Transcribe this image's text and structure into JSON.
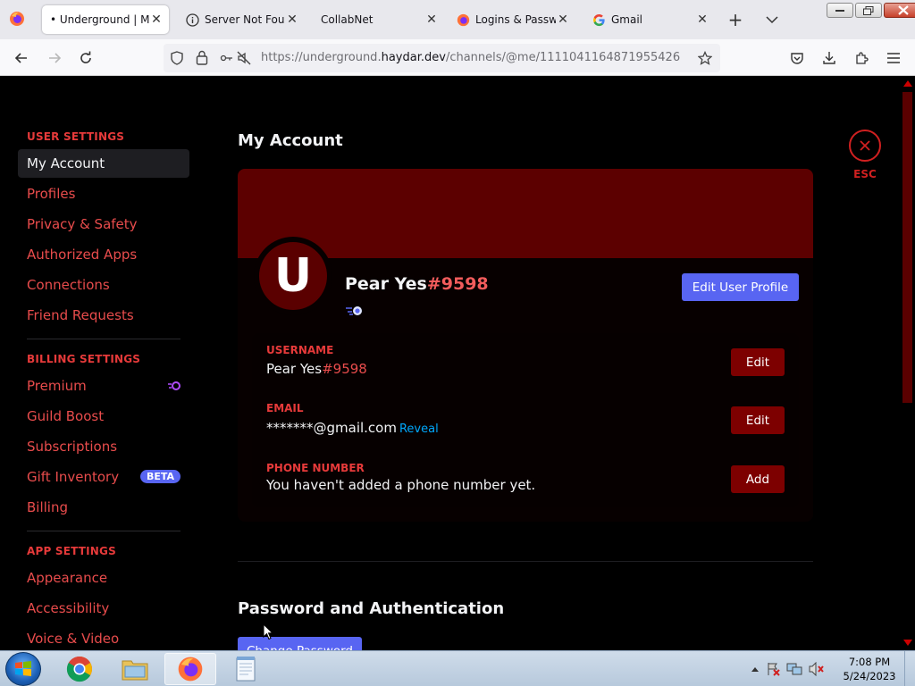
{
  "browser": {
    "tabs": [
      {
        "title": "• Underground | My Account",
        "icon": "firefox-icon",
        "active": true
      },
      {
        "title": "Server Not Found",
        "icon": "info-icon",
        "active": false
      },
      {
        "title": "CollabNet",
        "icon": "none",
        "active": false
      },
      {
        "title": "Logins & Passwords",
        "icon": "firefox-icon",
        "active": false
      },
      {
        "title": "Gmail",
        "icon": "google-icon",
        "active": false
      }
    ],
    "url_prefix": "https://underground.",
    "url_host": "haydar.dev",
    "url_path": "/channels/@me/1111041164871955426"
  },
  "sidebar": {
    "user_settings_header": "USER SETTINGS",
    "user_items": [
      "My Account",
      "Profiles",
      "Privacy & Safety",
      "Authorized Apps",
      "Connections",
      "Friend Requests"
    ],
    "billing_header": "BILLING SETTINGS",
    "billing_items": [
      "Premium",
      "Guild Boost",
      "Subscriptions",
      "Gift Inventory",
      "Billing"
    ],
    "beta_badge": "BETA",
    "app_header": "APP SETTINGS",
    "app_items": [
      "Appearance",
      "Accessibility",
      "Voice & Video"
    ]
  },
  "main": {
    "title": "My Account",
    "esc_label": "ESC",
    "profile": {
      "avatar_letter": "U",
      "name": "Pear Yes",
      "discriminator": "#9598",
      "edit_profile_label": "Edit User Profile"
    },
    "fields": {
      "username_label": "USERNAME",
      "username_name": "Pear Yes",
      "username_disc": "#9598",
      "email_label": "EMAIL",
      "email_value": "*******@gmail.com",
      "reveal_label": "Reveal",
      "phone_label": "PHONE NUMBER",
      "phone_value": "You haven't added a phone number yet.",
      "edit_label": "Edit",
      "add_label": "Add"
    },
    "password_section_title": "Password and Authentication",
    "change_password_label": "Change Password"
  },
  "taskbar": {
    "time": "7:08 PM",
    "date": "5/24/2023"
  },
  "colors": {
    "accent_red": "#e63a3a",
    "blurple": "#5865f2",
    "banner": "#5c0000",
    "button_red": "#7d0000"
  }
}
